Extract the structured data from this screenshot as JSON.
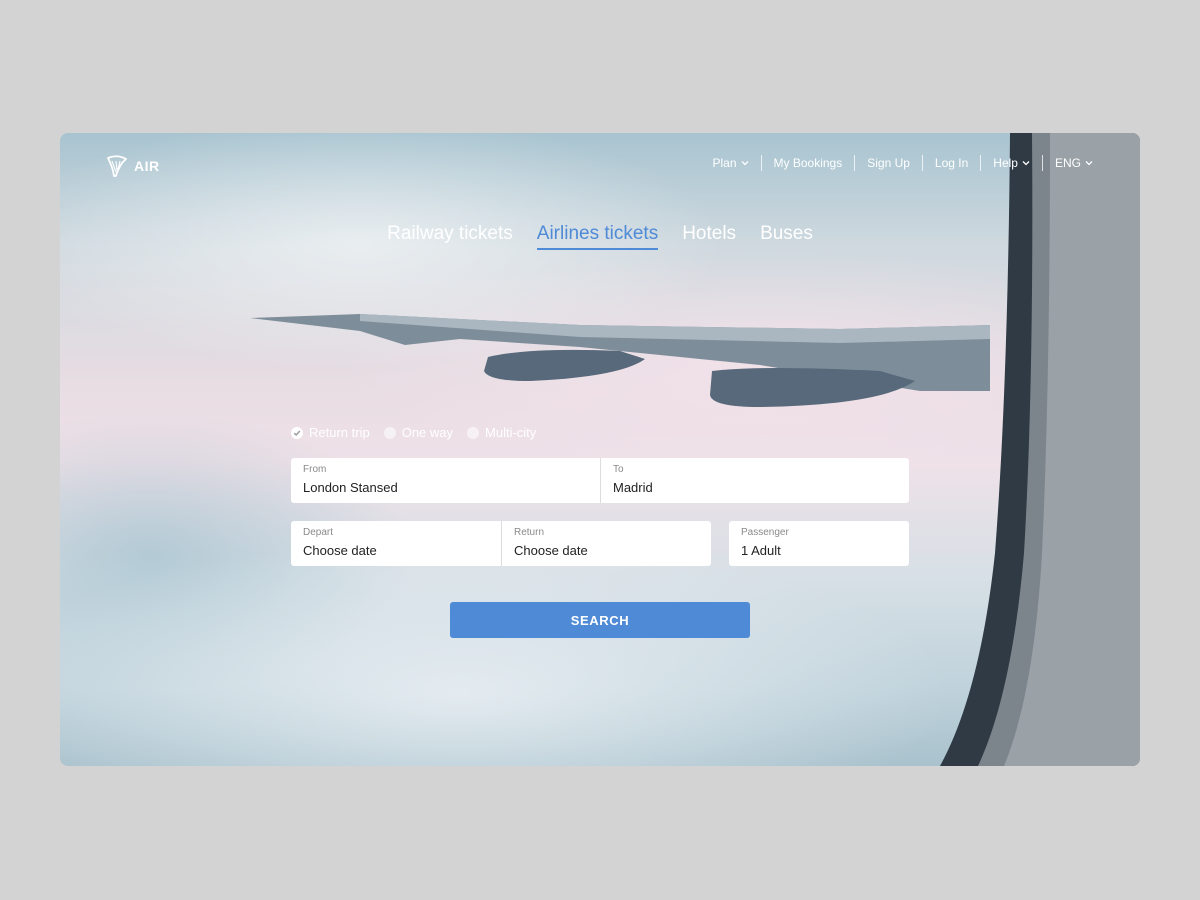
{
  "brand": {
    "name": "AIR",
    "logo_icon": "harp-logo-icon"
  },
  "nav": {
    "items": [
      {
        "label": "Plan",
        "dropdown": true
      },
      {
        "label": "My Bookings",
        "dropdown": false
      },
      {
        "label": "Sign Up",
        "dropdown": false
      },
      {
        "label": "Log In",
        "dropdown": false
      },
      {
        "label": "Help",
        "dropdown": true
      },
      {
        "label": "ENG",
        "dropdown": true
      }
    ]
  },
  "tabs": [
    {
      "label": "Railway tickets",
      "active": false
    },
    {
      "label": "Airlines tickets",
      "active": true
    },
    {
      "label": "Hotels",
      "active": false
    },
    {
      "label": "Buses",
      "active": false
    }
  ],
  "trip_types": [
    {
      "label": "Return trip",
      "selected": true
    },
    {
      "label": "One way",
      "selected": false
    },
    {
      "label": "Multi-city",
      "selected": false
    }
  ],
  "form": {
    "from": {
      "label": "From",
      "value": "London Stansed"
    },
    "to": {
      "label": "To",
      "value": "Madrid"
    },
    "depart": {
      "label": "Depart",
      "value": "Choose date"
    },
    "return": {
      "label": "Return",
      "value": "Choose date"
    },
    "passenger": {
      "label": "Passenger",
      "value": "1 Adult"
    },
    "search_label": "SEARCH"
  },
  "colors": {
    "accent": "#4f8ad6",
    "page_background": "#d3d3d3",
    "text_on_image": "#ffffff"
  }
}
